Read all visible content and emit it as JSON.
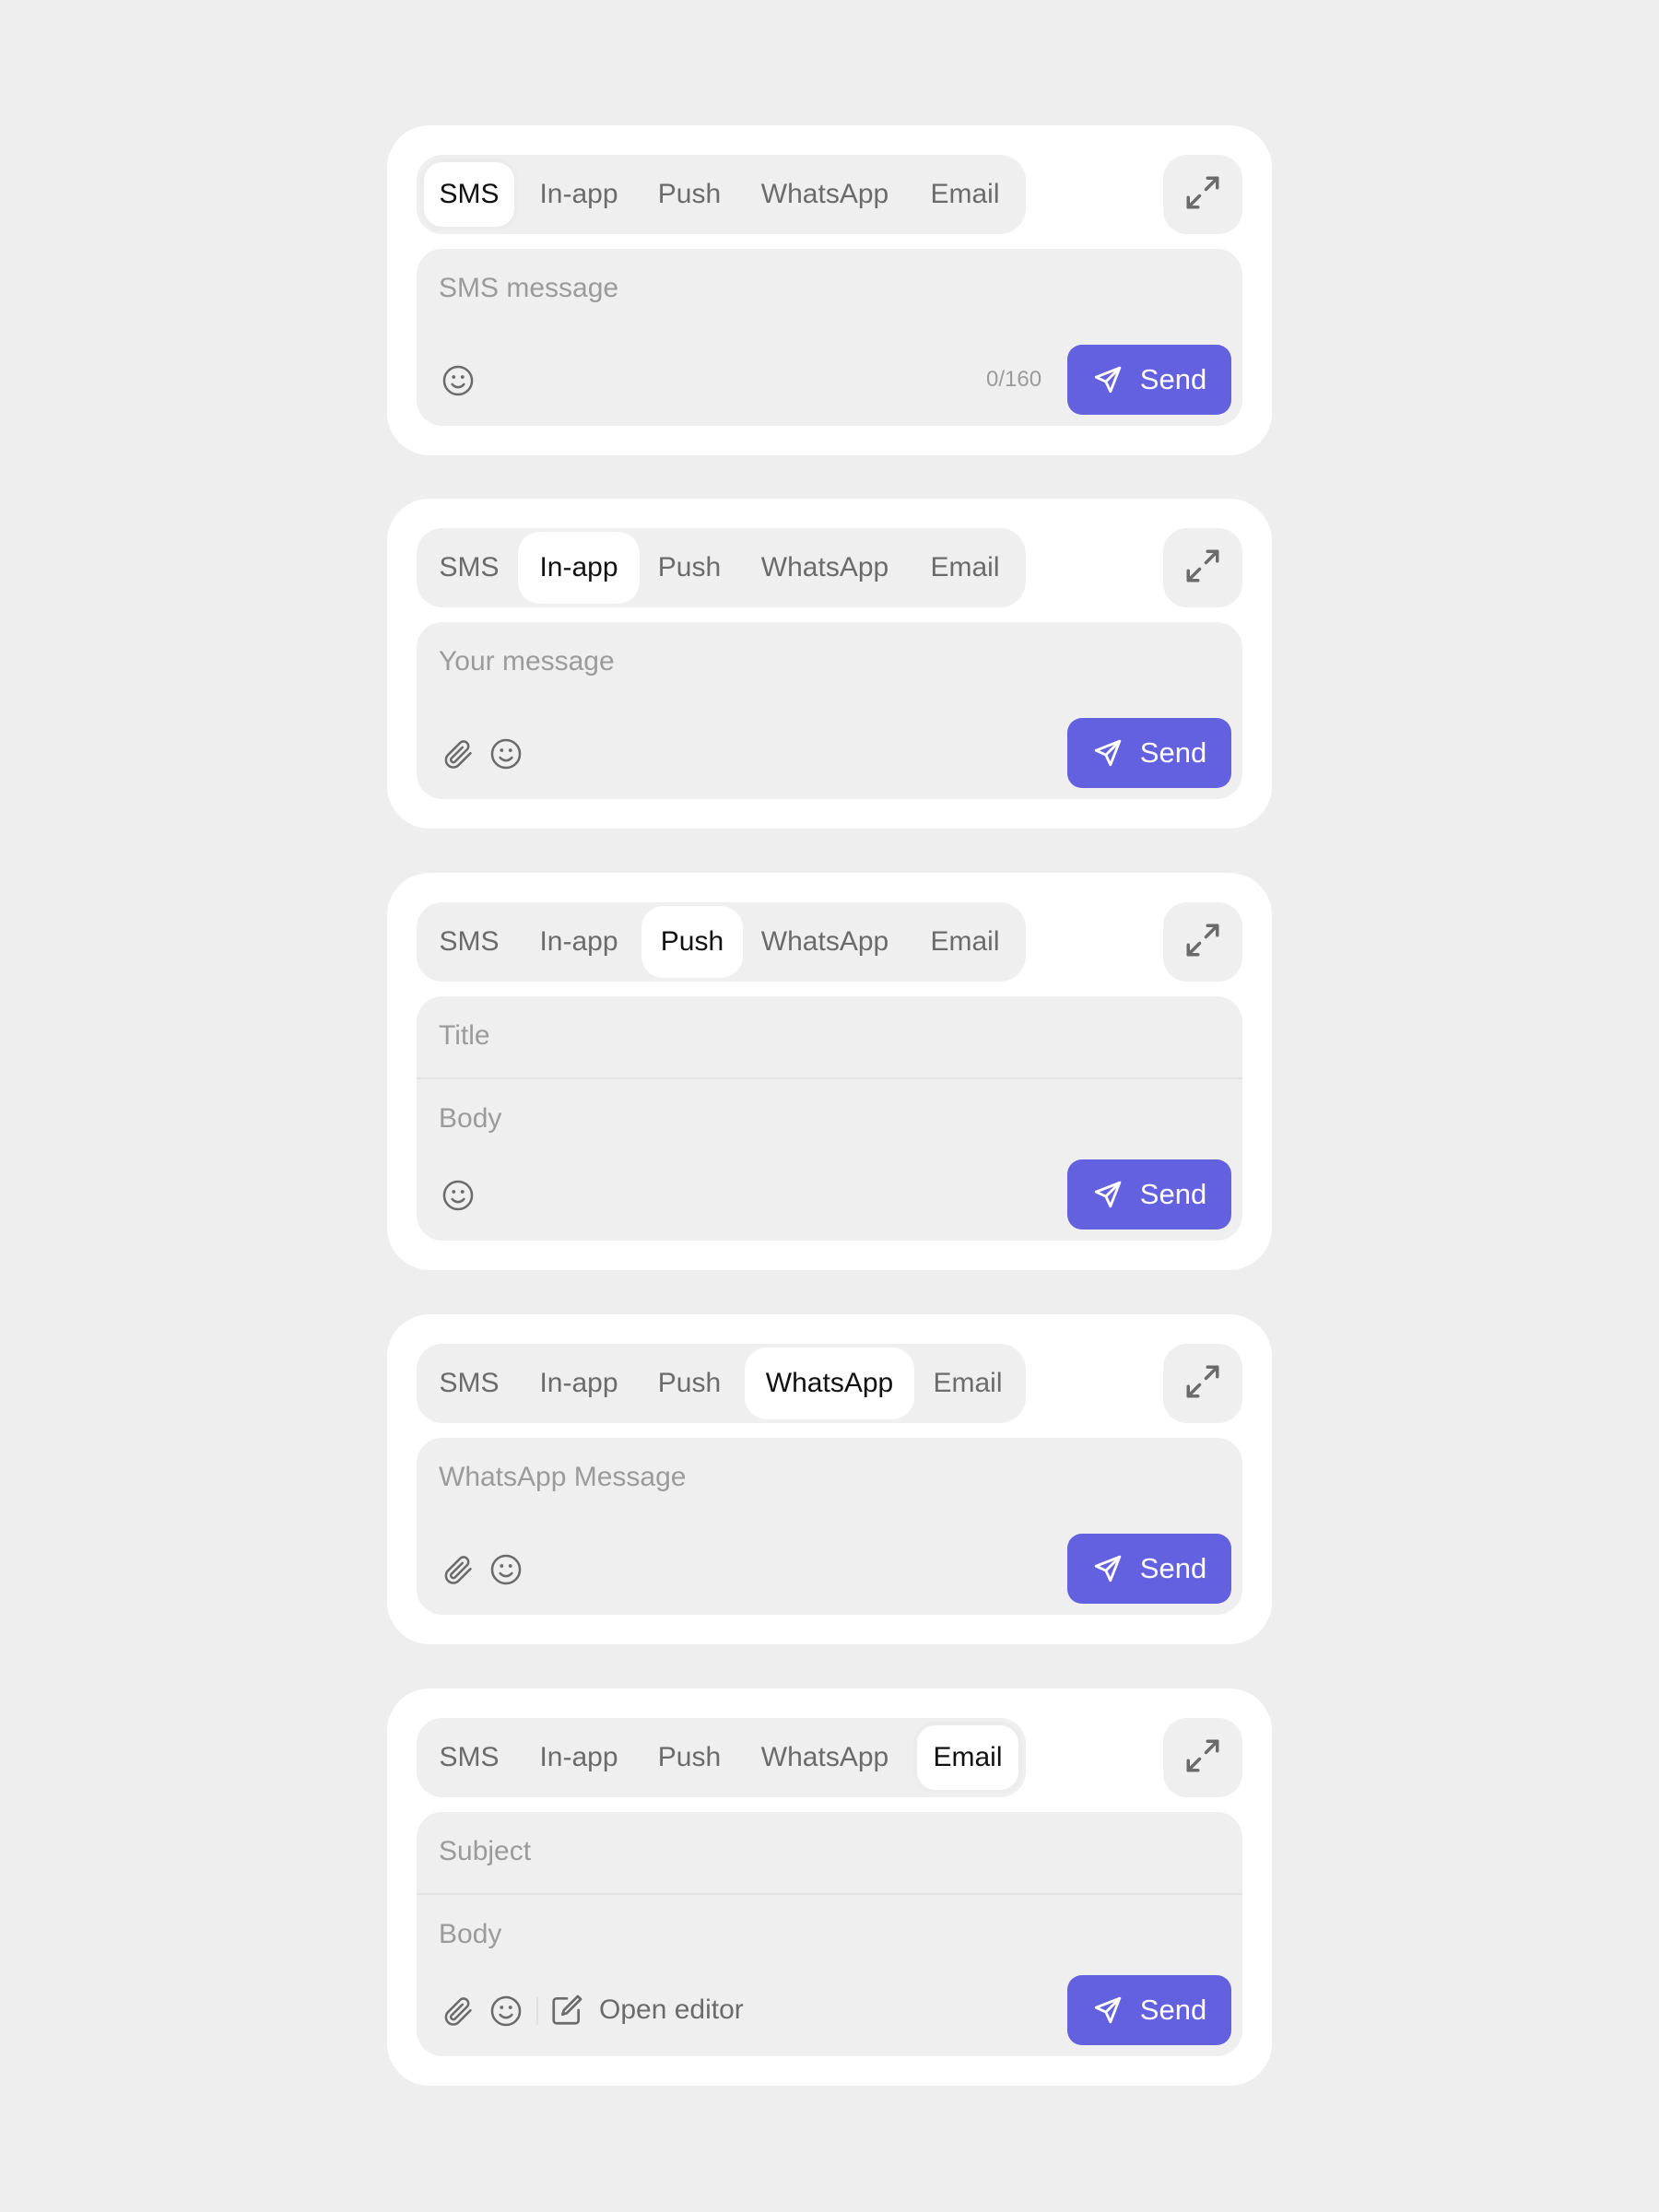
{
  "tabs": [
    "SMS",
    "In-app",
    "Push",
    "WhatsApp",
    "Email"
  ],
  "send_label": "Send",
  "accent_color": "#6461e0",
  "cards": [
    {
      "active_tab": "SMS",
      "fields": [
        "SMS message"
      ],
      "counter": "0/160",
      "tools": [
        "emoji-icon"
      ]
    },
    {
      "active_tab": "In-app",
      "fields": [
        "Your message"
      ],
      "tools": [
        "paperclip-icon",
        "emoji-icon"
      ]
    },
    {
      "active_tab": "Push",
      "fields": [
        "Title",
        "Body"
      ],
      "tools": [
        "emoji-icon"
      ]
    },
    {
      "active_tab": "WhatsApp",
      "fields": [
        "WhatsApp Message"
      ],
      "tools": [
        "paperclip-icon",
        "emoji-icon"
      ]
    },
    {
      "active_tab": "Email",
      "fields": [
        "Subject",
        "Body"
      ],
      "tools": [
        "paperclip-icon",
        "emoji-icon",
        "edit-icon"
      ],
      "open_editor_label": "Open editor"
    }
  ]
}
